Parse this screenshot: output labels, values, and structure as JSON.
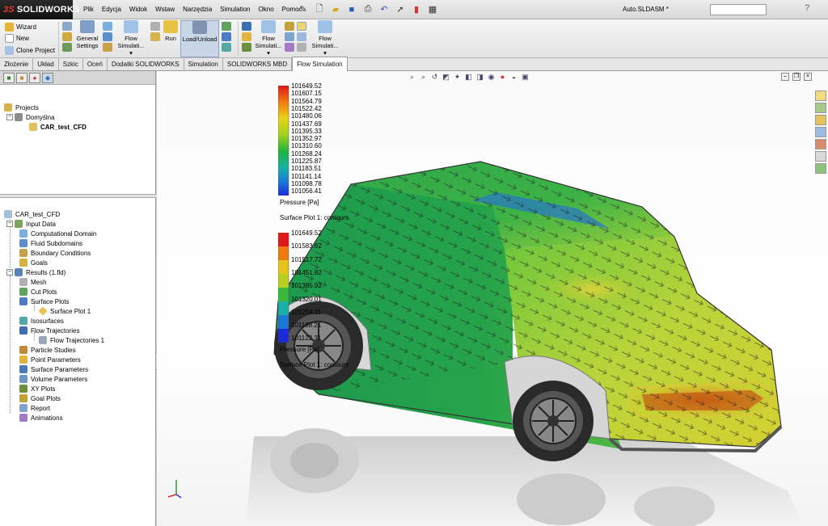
{
  "app": {
    "brand": "SOLIDWORKS",
    "document_title": "Auto.SLDASM *"
  },
  "menu": [
    "Plik",
    "Edycja",
    "Widok",
    "Wstaw",
    "Narzędzia",
    "Simulation",
    "Okno",
    "Pomoc"
  ],
  "quick_tools": [
    "pin-icon",
    "new-file-icon",
    "open-folder-icon",
    "save-icon",
    "print-icon",
    "undo-icon",
    "select-arrow-icon",
    "rebuild-light-icon",
    "options-icon"
  ],
  "command_manager": {
    "wizard": "Wizard",
    "new": "New",
    "clone_project": "Clone Project",
    "general_settings_1": "General",
    "general_settings_2": "Settings",
    "flow_sim_1_a": "Flow",
    "flow_sim_1_b": "Simulati...",
    "run": "Run",
    "load_unload": "Load/Unload",
    "flow_sim_2_a": "Flow",
    "flow_sim_2_b": "Simulati...",
    "flow_sim_3_a": "Flow",
    "flow_sim_3_b": "Simulati..."
  },
  "tabs": [
    "Złożenie",
    "Układ",
    "Szkic",
    "Oceń",
    "Dodatki SOLIDWORKS",
    "Simulation",
    "SOLIDWORKS MBD",
    "Flow Simulation"
  ],
  "active_tab": "Flow Simulation",
  "projects_tree": {
    "root": "Projects",
    "config": "Domyślna",
    "project": "CAR_test_CFD"
  },
  "analysis_tree": {
    "root": "CAR_test_CFD",
    "input_data": "Input Data",
    "input_items": [
      "Computational Domain",
      "Fluid Subdomains",
      "Boundary Conditions",
      "Goals"
    ],
    "results": "Results (1.fld)",
    "mesh": "Mesh",
    "cut_plots": "Cut Plots",
    "surface_plots": "Surface Plots",
    "surface_plot_1": "Surface Plot 1",
    "isosurfaces": "Isosurfaces",
    "flow_trajectories": "Flow Trajectories",
    "flow_trajectories_1": "Flow Trajectories 1",
    "result_items": [
      "Particle Studies",
      "Point Parameters",
      "Surface Parameters",
      "Volume Parameters",
      "XY Plots",
      "Goal Plots",
      "Report",
      "Animations"
    ]
  },
  "legend_top": {
    "values": [
      "101649.52",
      "101607.15",
      "101564.79",
      "101522.42",
      "101480.06",
      "101437.69",
      "101395.33",
      "101352.97",
      "101310.60",
      "101268.24",
      "101225.87",
      "101183.51",
      "101141.14",
      "101098.78",
      "101056.41"
    ],
    "unit_label": "Pressure [Pa]",
    "plot_label": "Surface Plot 1: contours"
  },
  "legend_bottom": {
    "values": [
      "101649.52",
      "101583.62",
      "101517.72",
      "101451.82",
      "101385.92",
      "101320.01",
      "101254.11",
      "101188.21",
      "101122.31"
    ],
    "unit_label": "Pressure [Pa]",
    "plot_label": "Surface Plot 1: contours"
  },
  "colors": {
    "accent": "#c9d6e6",
    "logo_red": "#e03a2f"
  }
}
